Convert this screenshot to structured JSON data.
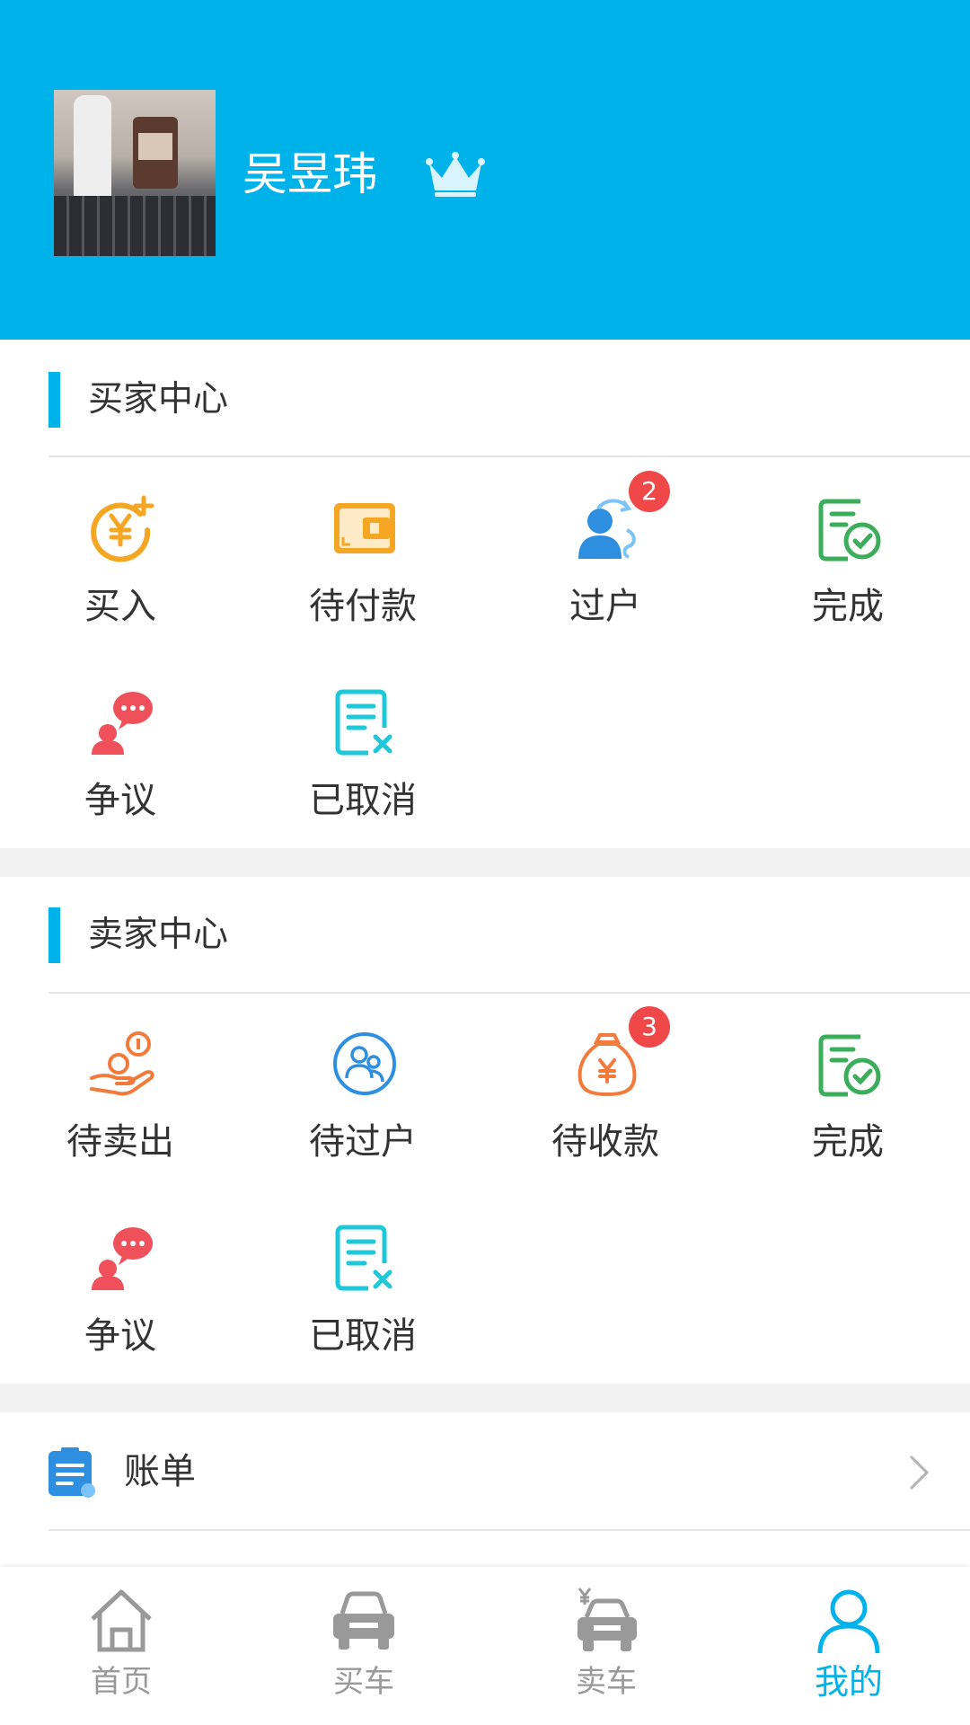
{
  "profile": {
    "username": "吴昱玮"
  },
  "buyer_center": {
    "title": "买家中心",
    "items": [
      {
        "label": "买入",
        "icon": "buy-in-yen-icon"
      },
      {
        "label": "待付款",
        "icon": "wallet-icon"
      },
      {
        "label": "过户",
        "icon": "transfer-person-icon",
        "badge": "2"
      },
      {
        "label": "完成",
        "icon": "completed-doc-icon"
      },
      {
        "label": "争议",
        "icon": "dispute-chat-icon"
      },
      {
        "label": "已取消",
        "icon": "cancelled-doc-icon"
      }
    ]
  },
  "seller_center": {
    "title": "卖家中心",
    "items": [
      {
        "label": "待卖出",
        "icon": "hand-coins-icon"
      },
      {
        "label": "待过户",
        "icon": "pending-transfer-icon"
      },
      {
        "label": "待收款",
        "icon": "money-bag-icon",
        "badge": "3"
      },
      {
        "label": "完成",
        "icon": "completed-doc-icon"
      },
      {
        "label": "争议",
        "icon": "dispute-chat-icon"
      },
      {
        "label": "已取消",
        "icon": "cancelled-doc-icon"
      }
    ]
  },
  "menu": {
    "bill_label": "账单"
  },
  "tabbar": [
    {
      "label": "首页",
      "icon": "home-icon"
    },
    {
      "label": "买车",
      "icon": "car-icon"
    },
    {
      "label": "卖车",
      "icon": "sell-car-icon"
    },
    {
      "label": "我的",
      "icon": "user-icon",
      "active": true
    }
  ],
  "colors": {
    "accent": "#00b2ea",
    "badge": "#f04848",
    "orange": "#f5a623",
    "green": "#3cad5b",
    "red": "#f0505a",
    "cyan": "#1ec8d8"
  }
}
